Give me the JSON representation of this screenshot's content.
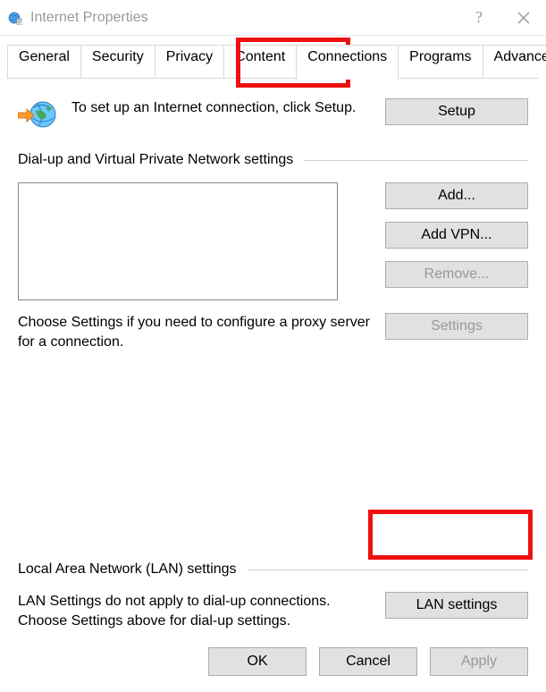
{
  "title": "Internet Properties",
  "tabs": [
    "General",
    "Security",
    "Privacy",
    "Content",
    "Connections",
    "Programs",
    "Advanced"
  ],
  "active_tab": 4,
  "setup": {
    "text": "To set up an Internet connection, click Setup.",
    "button": "Setup"
  },
  "dialup": {
    "header": "Dial-up and Virtual Private Network settings",
    "buttons": {
      "add": "Add...",
      "addvpn": "Add VPN...",
      "remove": "Remove...",
      "settings": "Settings"
    },
    "choose_text": "Choose Settings if you need to configure a proxy server for a connection."
  },
  "lan": {
    "header": "Local Area Network (LAN) settings",
    "text": "LAN Settings do not apply to dial-up connections. Choose Settings above for dial-up settings.",
    "button": "LAN settings"
  },
  "bottom": {
    "ok": "OK",
    "cancel": "Cancel",
    "apply": "Apply"
  }
}
